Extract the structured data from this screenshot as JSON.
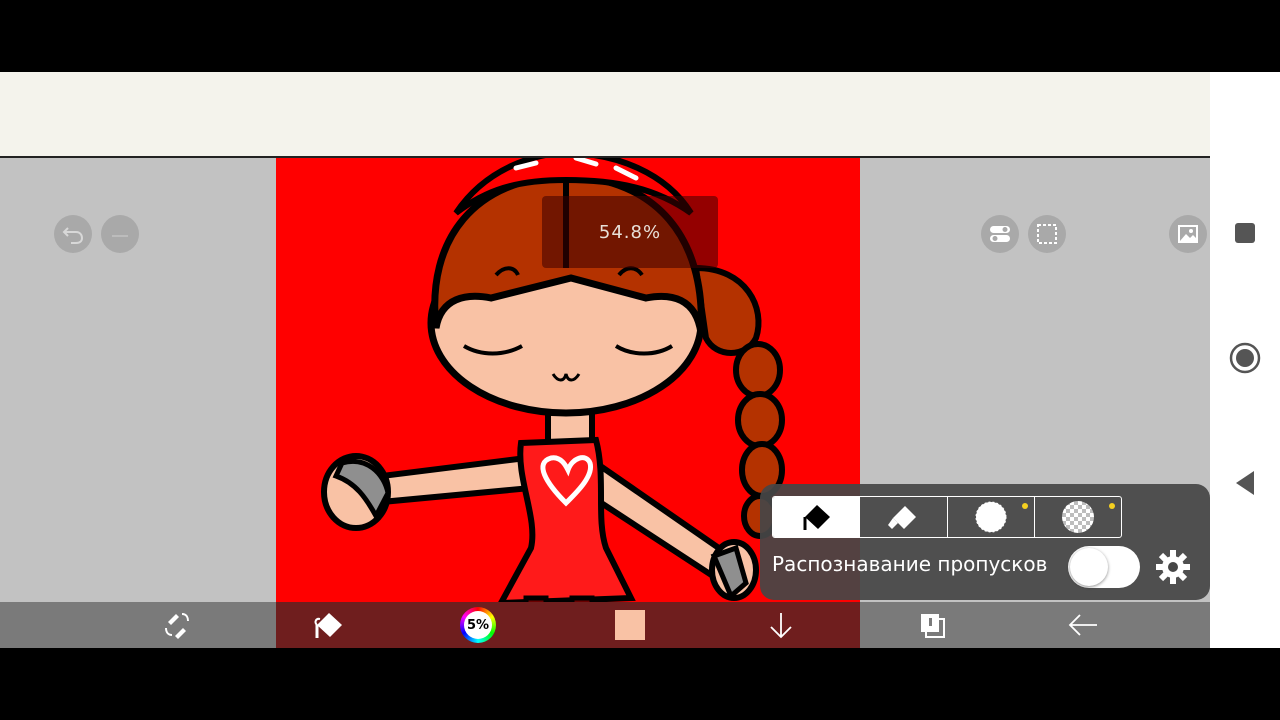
{
  "zoom": {
    "value": "54.8%"
  },
  "top_left_buttons": {
    "undo_icon": "undo-icon",
    "redo_icon": "redo-icon"
  },
  "top_right_buttons": {
    "toggle_icon": "toggle-icon",
    "selection_icon": "selection-icon",
    "reference_icon": "image-icon"
  },
  "brush_panel": {
    "tabs": [
      {
        "icon": "fill-bucket-icon",
        "active": true
      },
      {
        "icon": "eraser-icon",
        "active": false
      },
      {
        "icon": "circle-brush-icon",
        "active": false,
        "dot": true
      },
      {
        "icon": "transparent-brush-icon",
        "active": false,
        "dot": true
      }
    ],
    "gap_closing_label": "Распознавание пропусков",
    "gap_closing_enabled": false,
    "settings_icon": "gear-icon"
  },
  "toolbar": {
    "color_wheel_label": "5%",
    "current_color": "#f9c2a5",
    "items": [
      "transform-tools-icon",
      "fill-bucket-icon",
      "color-wheel-icon",
      "color-swatch",
      "download-icon",
      "layers-icon",
      "back-arrow-icon"
    ]
  },
  "nav": {
    "items": [
      "stop-icon",
      "record-icon",
      "back-triangle-icon"
    ]
  },
  "colors": {
    "canvas_bg": "#ff0000",
    "panel": "#464646",
    "toolbar": "#7a7a7a",
    "accent_dot": "#f5d020"
  }
}
